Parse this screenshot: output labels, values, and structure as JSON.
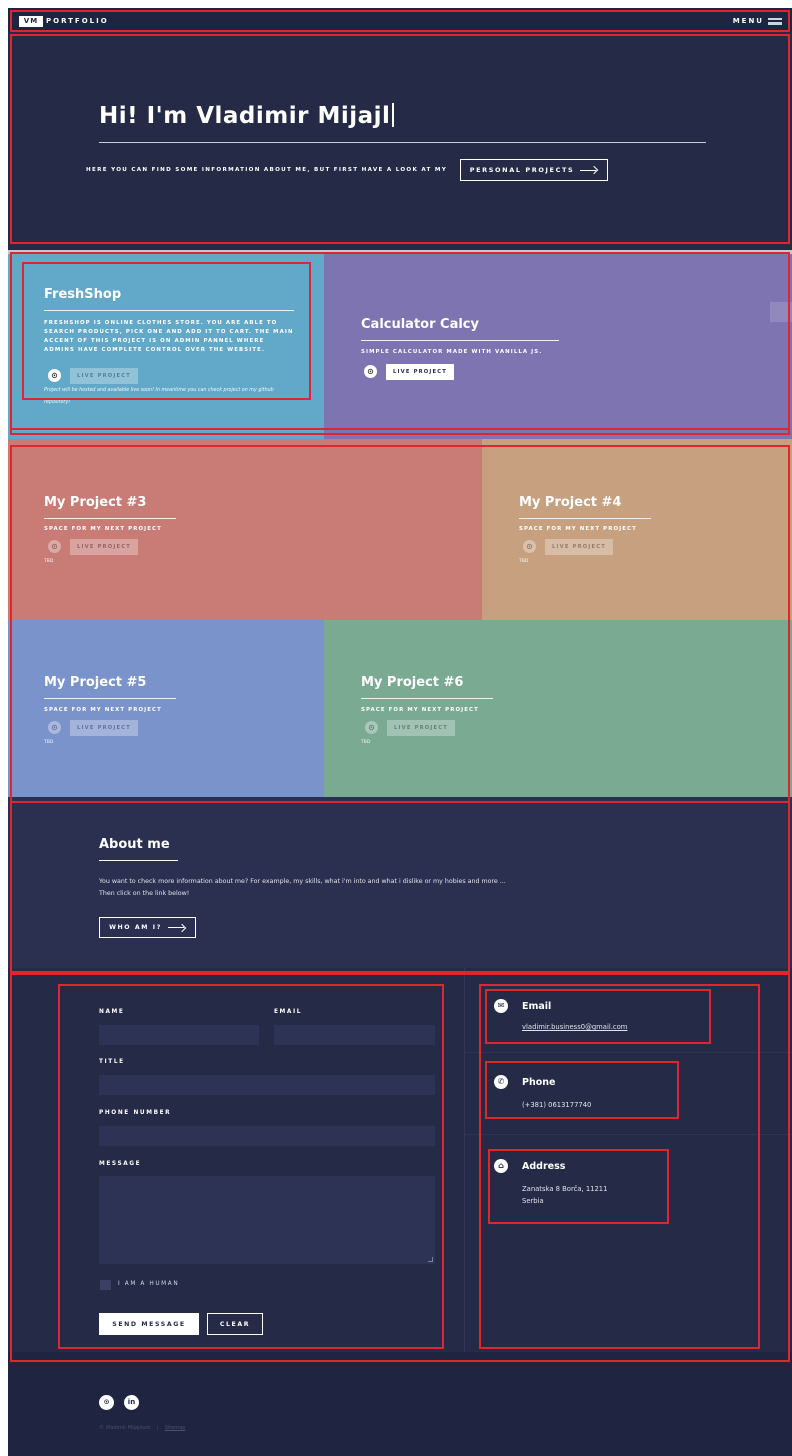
{
  "nav": {
    "logo_mark": "VM",
    "logo_text": "PORTFOLIO",
    "menu_label": "MENU"
  },
  "hero": {
    "title": "Hi! I'm Vladimir Mijajl",
    "subtitle": "HERE YOU CAN FIND SOME INFORMATION ABOUT ME, BUT FIRST HAVE A LOOK AT MY",
    "button_label": "PERSONAL PROJECTS"
  },
  "projects": [
    {
      "name": "FreshShop",
      "description": "FRESHSHOP IS ONLINE CLOTHES STORE. YOU ARE ABLE TO SEARCH PRODUCTS, PICK ONE AND ADD IT TO CART. THE MAIN ACCENT OF THIS PROJECT IS ON ADMIN PANNEL WHERE ADMINS HAVE COMPLETE CONTROL OVER THE WEBSITE.",
      "live_label": "LIVE PROJECT",
      "note": "Project will be hosted and available live soon! In meantime you can check project on my github repository!",
      "color": "#62a8c8"
    },
    {
      "name": "Calculator Calcy",
      "description": "SIMPLE CALCULATOR MADE WITH VANILLA JS.",
      "live_label": "LIVE PROJECT",
      "color": "#7e74b1"
    },
    {
      "name": "My Project #3",
      "description": "SPACE FOR MY NEXT PROJECT",
      "live_label": "LIVE PROJECT",
      "tbd": "TBD",
      "color": "#c97c75"
    },
    {
      "name": "My Project #4",
      "description": "SPACE FOR MY NEXT PROJECT",
      "live_label": "LIVE PROJECT",
      "tbd": "TBD",
      "color": "#c6a07f"
    },
    {
      "name": "My Project #5",
      "description": "SPACE FOR MY NEXT PROJECT",
      "live_label": "LIVE PROJECT",
      "tbd": "TBD",
      "color": "#7b93cb"
    },
    {
      "name": "My Project #6",
      "description": "SPACE FOR MY NEXT PROJECT",
      "live_label": "LIVE PROJECT",
      "tbd": "TBD",
      "color": "#7aaa92"
    }
  ],
  "about": {
    "title": "About me",
    "text_line1": "You want to check more information about me? For example, my skills, what i'm into and what i dislike or my hobies and more ...",
    "text_line2": "Then click on the link below!",
    "button_label": "WHO AM I?"
  },
  "form": {
    "name_label": "NAME",
    "email_label": "EMAIL",
    "title_label": "TITLE",
    "phone_label": "PHONE NUMBER",
    "message_label": "MESSAGE",
    "human_label": "I AM A HUMAN",
    "send_label": "SEND MESSAGE",
    "clear_label": "CLEAR"
  },
  "contact_info": {
    "email_title": "Email",
    "email_value": "vladimir.business0@gmail.com",
    "phone_title": "Phone",
    "phone_value": "(+381) 0613177740",
    "address_title": "Address",
    "address_line1": "Zanatska 8 Borča, 11211",
    "address_line2": "Serbia"
  },
  "footer": {
    "copyright": "© Vladimir Mijajlović",
    "sitemap": "Sitemap",
    "icons": [
      "github-icon",
      "linkedin-icon"
    ]
  },
  "colors": {
    "page_bg": "#252a46",
    "accent_annotation": "#e0262d"
  }
}
